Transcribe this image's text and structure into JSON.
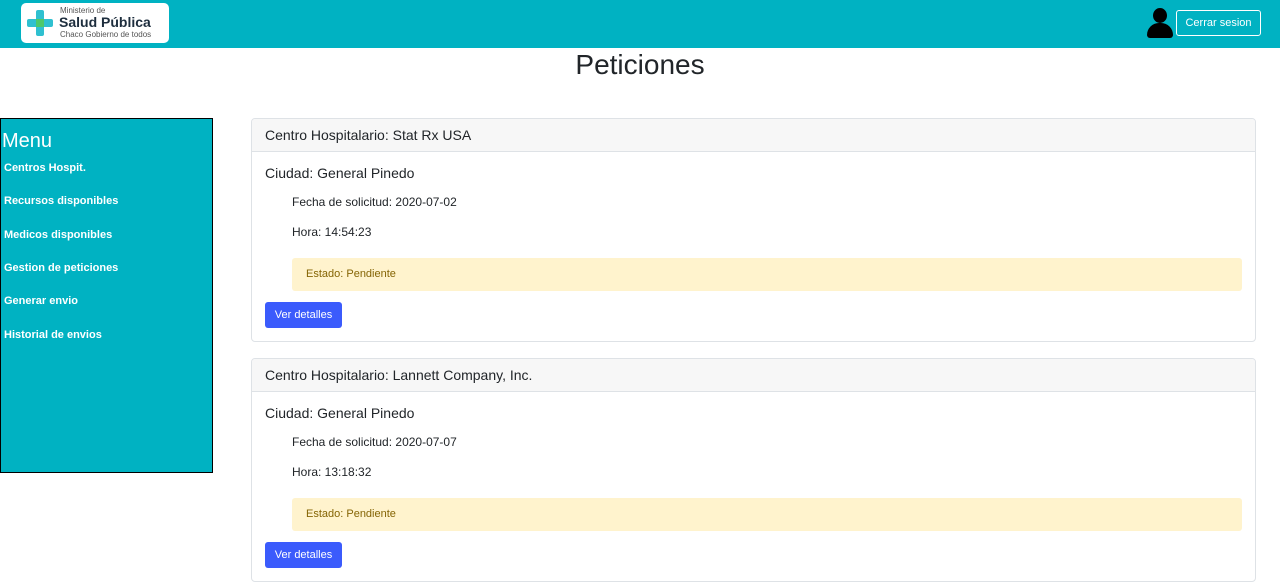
{
  "header": {
    "logo": {
      "line1": "Ministerio de",
      "line2": "Salud Pública",
      "line3": "Chaco Gobierno de todos"
    },
    "user_icon": "user-icon",
    "logout_label": "Cerrar sesion"
  },
  "page_title": "Peticiones",
  "sidebar": {
    "title": "Menu",
    "items": [
      {
        "label": "Centros Hospit."
      },
      {
        "label": "Recursos disponibles"
      },
      {
        "label": "Medicos disponibles"
      },
      {
        "label": "Gestion de peticiones"
      },
      {
        "label": "Generar envio"
      },
      {
        "label": "Historial de envios"
      }
    ]
  },
  "requests": [
    {
      "hospital": "Centro Hospitalario: Stat Rx USA",
      "city": "Ciudad: General Pinedo",
      "date": "Fecha de solicitud: 2020-07-02",
      "time": "Hora: 14:54:23",
      "status": "Estado: Pendiente",
      "button": "Ver detalles"
    },
    {
      "hospital": "Centro Hospitalario: Lannett Company, Inc.",
      "city": "Ciudad: General Pinedo",
      "date": "Fecha de solicitud: 2020-07-07",
      "time": "Hora: 13:18:32",
      "status": "Estado: Pendiente",
      "button": "Ver detalles"
    }
  ],
  "colors": {
    "primary": "#00b2c2",
    "button": "#3b5bfc",
    "status_bg": "#fff3cd",
    "status_text": "#856404"
  }
}
